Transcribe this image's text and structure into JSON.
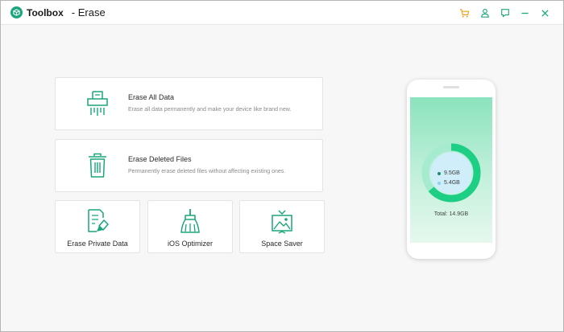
{
  "app": {
    "brand": "Toolbox",
    "module": "- Erase"
  },
  "colors": {
    "accent": "#1aa67c",
    "cart": "#f0a01e",
    "used": "#1ccf84",
    "free": "#9bd9f3"
  },
  "titlebar_icons": [
    "cart-icon",
    "user-icon",
    "feedback-icon",
    "minimize-icon",
    "close-icon"
  ],
  "options": {
    "erase_all": {
      "icon": "shredder-icon",
      "title": "Erase All Data",
      "description": "Erase all data permanently and make your device like brand new."
    },
    "erase_deleted": {
      "icon": "trash-icon",
      "title": "Erase Deleted Files",
      "description": "Permanently erase deleted files without affecting existing ones."
    },
    "erase_private": {
      "icon": "private-document-icon",
      "label": "Erase Private Data"
    },
    "ios_optimizer": {
      "icon": "broom-icon",
      "label": "iOS Optimizer"
    },
    "space_saver": {
      "icon": "image-compress-icon",
      "label": "Space Saver"
    }
  },
  "device": {
    "storage": {
      "used": "9.5GB",
      "free": "5.4GB",
      "total": "Total: 14.9GB",
      "used_fraction": 0.64
    }
  }
}
